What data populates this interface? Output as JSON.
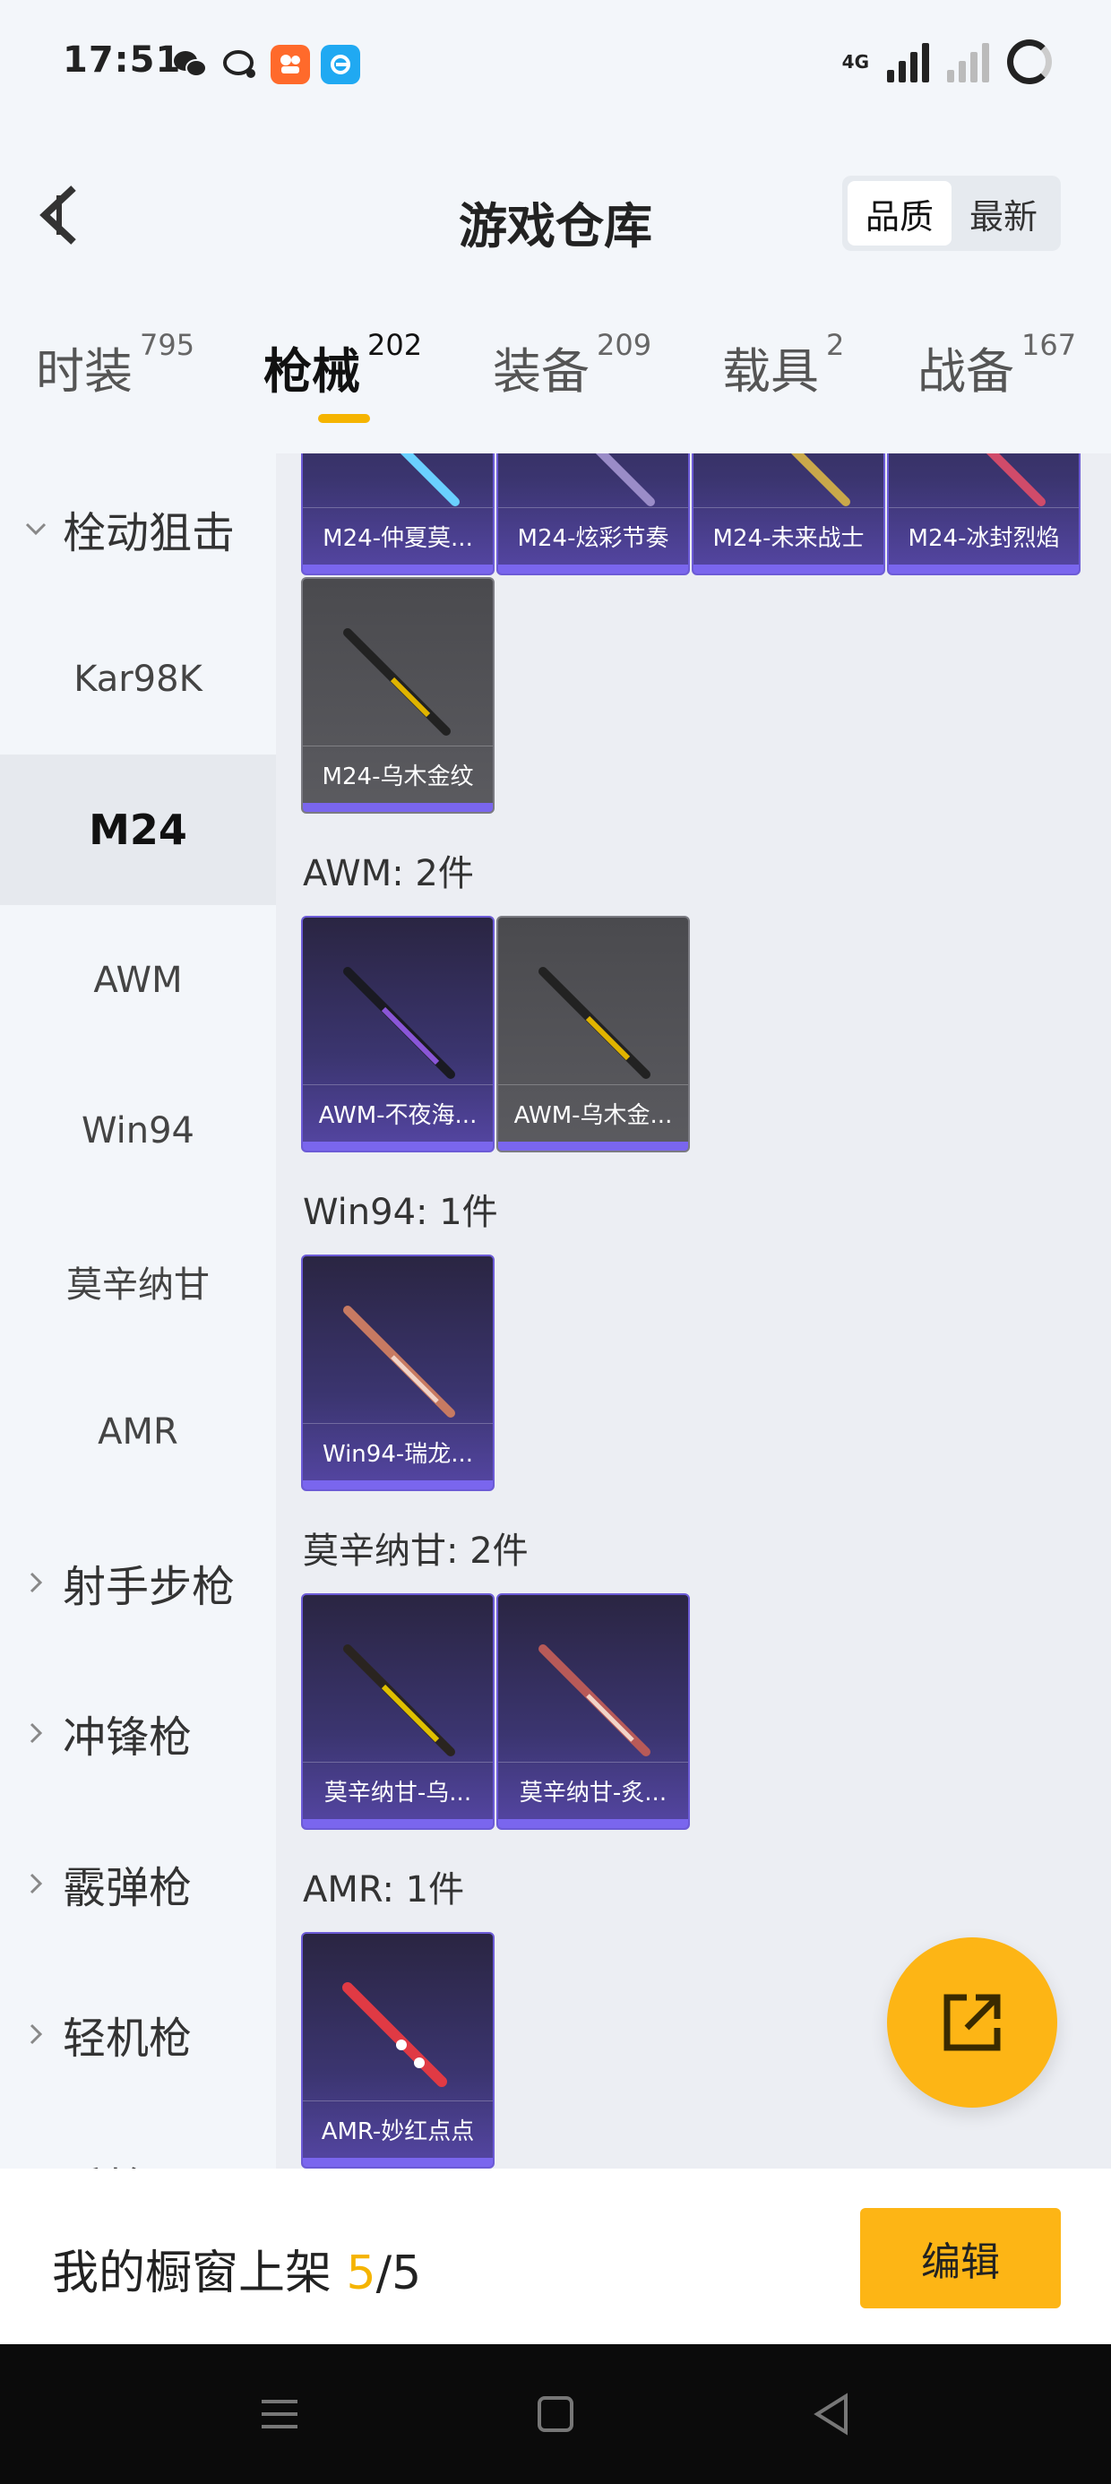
{
  "status_bar": {
    "time": "17:51",
    "network": "4G",
    "left_icons": [
      "wechat-icon",
      "chat-icon",
      "app-icon",
      "browser-icon"
    ]
  },
  "header": {
    "title": "游戏仓库",
    "sort_options": [
      "品质",
      "最新"
    ],
    "active_sort": "品质"
  },
  "tabs": [
    {
      "label": "时装",
      "count": "795"
    },
    {
      "label": "枪械",
      "count": "202",
      "active": true
    },
    {
      "label": "装备",
      "count": "209"
    },
    {
      "label": "载具",
      "count": "2"
    },
    {
      "label": "战备",
      "count": "167"
    }
  ],
  "sidebar": {
    "items": [
      {
        "label": "栓动狙击",
        "type": "group",
        "expanded": true
      },
      {
        "label": "Kar98K"
      },
      {
        "label": "M24",
        "active": true
      },
      {
        "label": "AWM"
      },
      {
        "label": "Win94"
      },
      {
        "label": "莫辛纳甘"
      },
      {
        "label": "AMR"
      },
      {
        "label": "射手步枪",
        "type": "group"
      },
      {
        "label": "冲锋枪",
        "type": "group"
      },
      {
        "label": "霰弹枪",
        "type": "group"
      },
      {
        "label": "轻机枪",
        "type": "group"
      },
      {
        "label": "手枪",
        "type": "group"
      }
    ]
  },
  "content": {
    "m24_row": [
      "M24-仲夏莫...",
      "M24-炫彩节奏",
      "M24-未来战士",
      "M24-冰封烈焰"
    ],
    "m24_extra": "M24-乌木金纹",
    "sections": [
      {
        "title": "AWM: 2件",
        "items": [
          "AWM-不夜海...",
          "AWM-乌木金..."
        ]
      },
      {
        "title": "Win94: 1件",
        "items": [
          "Win94-瑞龙..."
        ]
      },
      {
        "title": "莫辛纳甘: 2件",
        "items": [
          "莫辛纳甘-乌...",
          "莫辛纳甘-炙..."
        ]
      },
      {
        "title": "AMR: 1件",
        "items": [
          "AMR-妙红点点"
        ]
      }
    ]
  },
  "bottom_bar": {
    "showcase_prefix": "我的橱窗上架 ",
    "showcase_count": "5",
    "showcase_total": "/5",
    "edit_label": "编辑"
  },
  "colors": {
    "accent": "#fdb515",
    "card_purple": "#3b3570",
    "card_border": "#6c5bd6"
  }
}
